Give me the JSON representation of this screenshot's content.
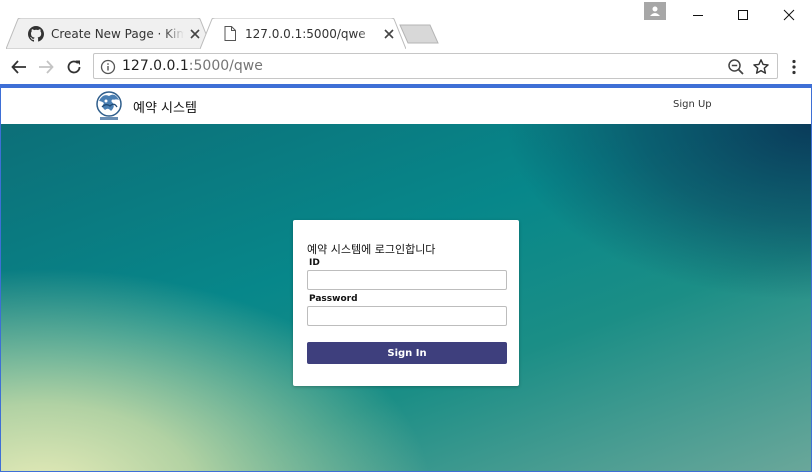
{
  "browser": {
    "tabs": [
      {
        "title": "Create New Page · KimJ",
        "icon": "github-icon",
        "active": false
      },
      {
        "title": "127.0.0.1:5000/qwe",
        "icon": "page-icon",
        "active": true
      }
    ],
    "address": {
      "host": "127.0.0.1",
      "path": ":5000/qwe"
    },
    "accent_color": "#3e6fd6"
  },
  "site": {
    "brand_name": "예약 시스템",
    "nav_signup": "Sign Up",
    "login": {
      "heading": "예약 시스템에 로그인합니다",
      "id_label": "ID",
      "id_value": "",
      "password_label": "Password",
      "password_value": "",
      "signin_label": "Sign In",
      "button_color": "#3e3f7d"
    }
  }
}
